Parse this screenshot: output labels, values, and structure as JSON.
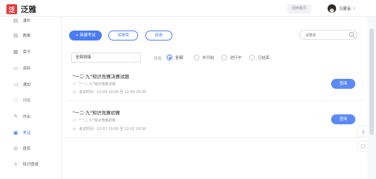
{
  "app": {
    "logo_char": "泛",
    "title": "泛雅"
  },
  "header": {
    "back_label": "回到首页",
    "user_name": "马蒙话",
    "caret": "∨"
  },
  "sidebar": {
    "items": [
      {
        "label": "课件",
        "icon": "▤"
      },
      {
        "label": "教案",
        "icon": "▤"
      },
      {
        "label": "章节",
        "icon": "▦"
      },
      {
        "label": "资料",
        "icon": "▭"
      },
      {
        "label": "通知",
        "icon": "◁"
      },
      {
        "label": "讨论",
        "icon": "◌"
      },
      {
        "label": "作业",
        "icon": "✎"
      },
      {
        "label": "考试",
        "icon": "▣"
      },
      {
        "label": "题库",
        "icon": "◎"
      },
      {
        "label": "知识图谱",
        "icon": "⅄"
      }
    ],
    "active_index": 7
  },
  "toolbar": {
    "new_exam": "+ 新建考试",
    "exam_bank": "试卷库",
    "marking": "批卷",
    "search_placeholder": "试卷名"
  },
  "filter": {
    "select_value": "全部班级",
    "status_label": "状态",
    "options": [
      "全部",
      "未开始",
      "进行中",
      "已结束"
    ],
    "selected": "全部"
  },
  "exams": [
    {
      "title": "\"一二·九\"知识竞赛决赛试题",
      "subtitle": "\"一二·九\"知识竞赛决赛",
      "time": "考试时间：12-04 19:00 至 12-04 19:30",
      "action": "查阅"
    },
    {
      "title": "\"一二·九\"知识竞赛初赛",
      "subtitle": "\"一二·九\"知识竞赛初赛",
      "time": "考试时间：12-01 19:00 至 12-01 19:30",
      "action": "查阅"
    }
  ],
  "floating": {
    "download_icon": "⤓",
    "note_icon": "▢"
  },
  "colors": {
    "accent": "#4b7cf3",
    "logo": "#e23b3b"
  }
}
